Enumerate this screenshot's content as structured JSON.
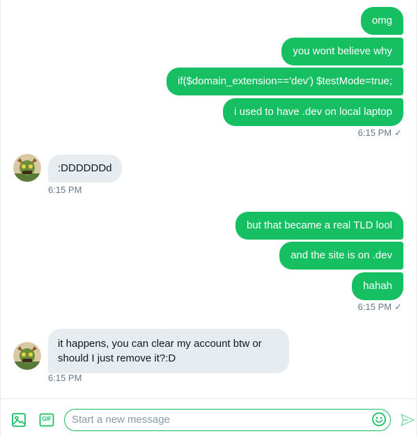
{
  "conversation": {
    "messages": [
      {
        "direction": "out",
        "text": "omg"
      },
      {
        "direction": "out",
        "text": "you wont believe why"
      },
      {
        "direction": "out",
        "text": "if($domain_extension=='dev') $testMode=true;"
      },
      {
        "direction": "out",
        "text": "i used to have .dev on local laptop"
      },
      {
        "direction": "in",
        "text": ":DDDDDDd"
      },
      {
        "direction": "out",
        "text": "but that became a real TLD lool"
      },
      {
        "direction": "out",
        "text": "and the site is on .dev"
      },
      {
        "direction": "out",
        "text": "hahah"
      },
      {
        "direction": "in",
        "text": "it happens, you can clear my account btw or should I just remove it?:D"
      }
    ],
    "timestamps": {
      "group1": "6:15 PM",
      "group2": "6:15 PM",
      "group3": "6:15 PM",
      "group4": "6:15 PM"
    },
    "read_mark": "✓"
  },
  "composer": {
    "placeholder": "Start a new message",
    "gif_label": "GIF"
  },
  "colors": {
    "accent": "#17bf63",
    "incoming_bubble": "#e6ecf0",
    "meta_text": "#657786"
  }
}
